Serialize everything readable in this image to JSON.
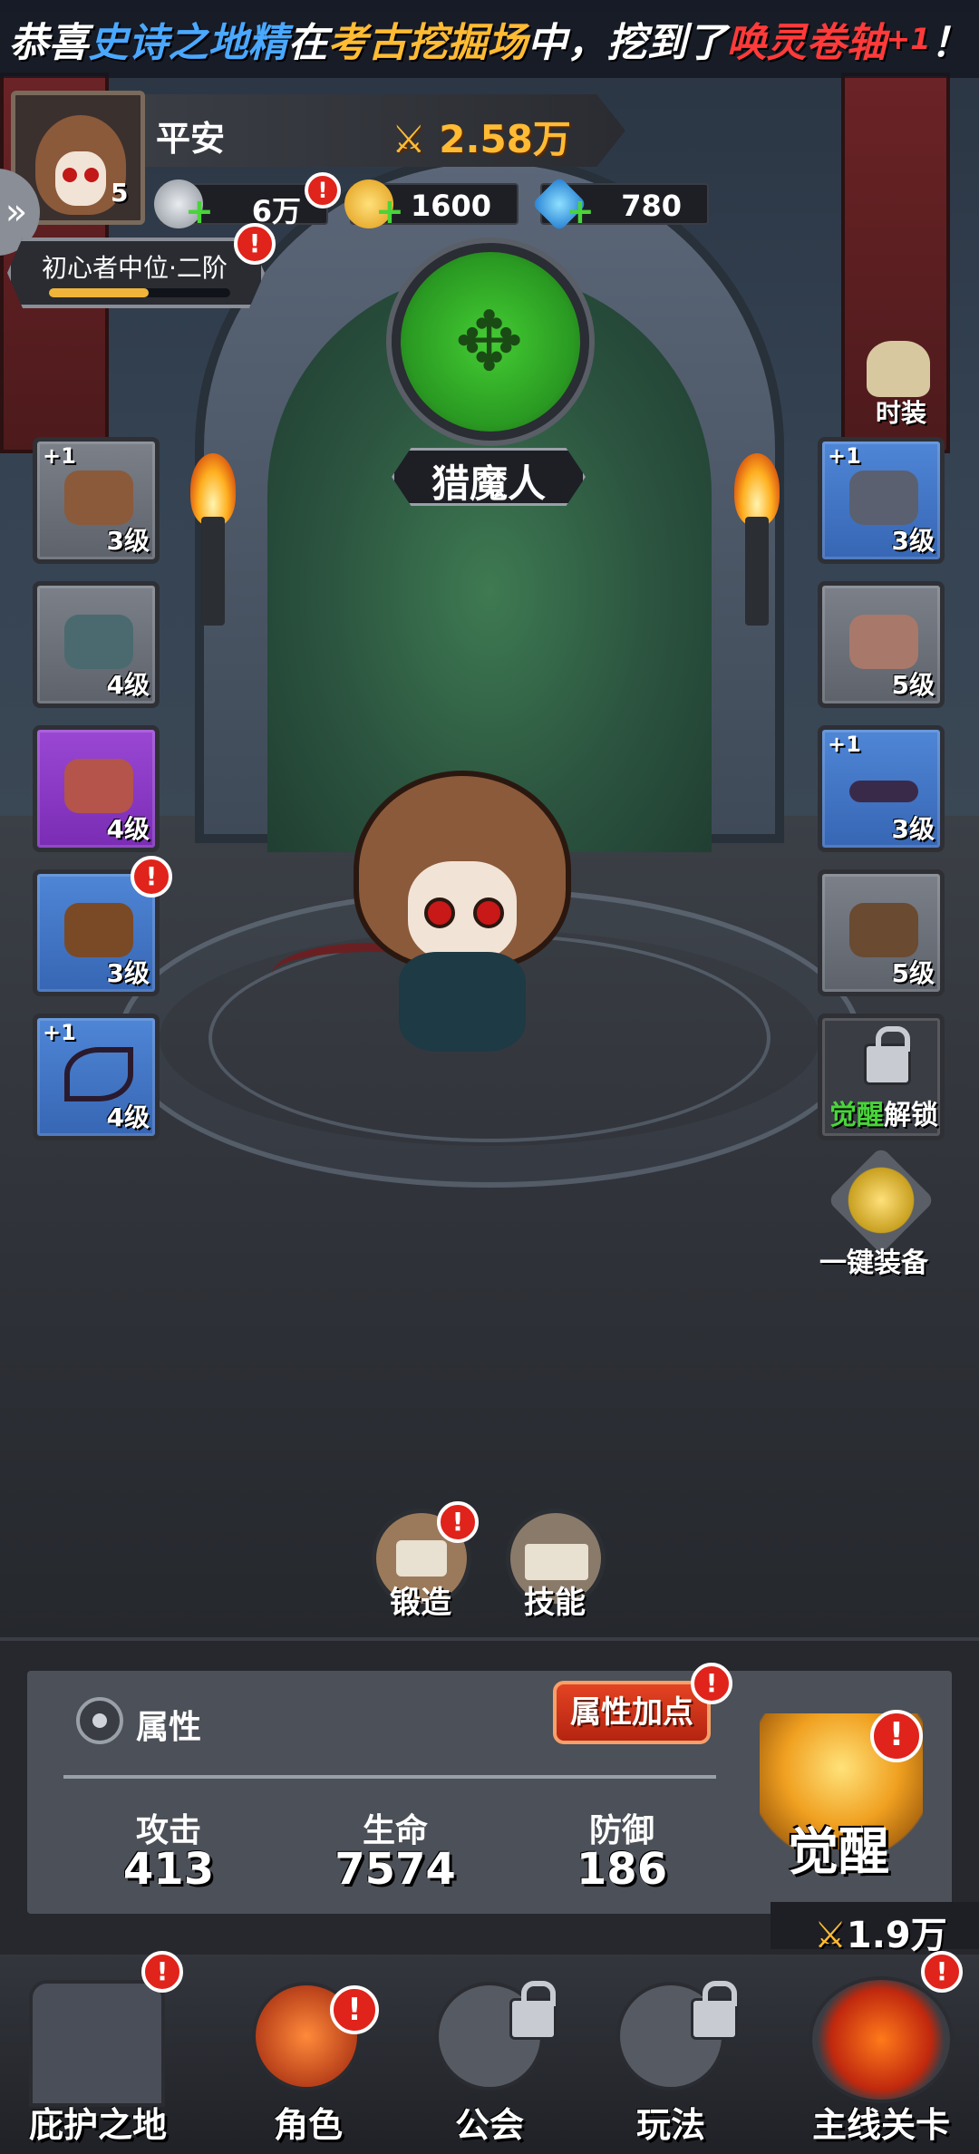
{
  "ticker": {
    "part1": "恭喜",
    "player": "史诗之地精",
    "part2": "在",
    "place": "考古挖掘场",
    "part3": "中，挖到了",
    "item": "唤灵卷轴",
    "qty": "+1",
    "end": "！"
  },
  "profile": {
    "name": "平安",
    "level": "5",
    "power": "2.58万",
    "rank": "初心者中位·二阶",
    "rank_progress": 0.55
  },
  "currency": {
    "silver": "6万",
    "gold": "1600",
    "gem": "780"
  },
  "class": {
    "name": "猎魔人"
  },
  "costume_label": "时装",
  "equipment_left": [
    {
      "plus": "+1",
      "level": "3级",
      "rarity": "gray",
      "icon": "hood-icon"
    },
    {
      "plus": "",
      "level": "4级",
      "rarity": "gray",
      "icon": "mask-icon"
    },
    {
      "plus": "",
      "level": "4级",
      "rarity": "purple",
      "icon": "cape-icon"
    },
    {
      "plus": "",
      "level": "3级",
      "rarity": "blue",
      "icon": "pants-icon"
    },
    {
      "plus": "+1",
      "level": "4级",
      "rarity": "blue",
      "icon": "bow-icon"
    }
  ],
  "equipment_right": [
    {
      "plus": "+1",
      "level": "3级",
      "rarity": "blue",
      "icon": "armor-icon"
    },
    {
      "plus": "",
      "level": "5级",
      "rarity": "gray",
      "icon": "bracer-icon"
    },
    {
      "plus": "+1",
      "level": "3级",
      "rarity": "blue",
      "icon": "belt-icon"
    },
    {
      "plus": "",
      "level": "5级",
      "rarity": "gray",
      "icon": "boots-icon"
    }
  ],
  "awaken_unlock": {
    "part1": "觉醒",
    "part2": "解锁"
  },
  "one_click_equip": "一键装备",
  "actions": {
    "forge": "锻造",
    "skill": "技能"
  },
  "attributes": {
    "title": "属性",
    "add_points": "属性加点",
    "attack_label": "攻击",
    "attack": "413",
    "hp_label": "生命",
    "hp": "7574",
    "defense_label": "防御",
    "defense": "186",
    "awaken": "觉醒",
    "power": "1.9万"
  },
  "nav": [
    {
      "label": "庇护之地"
    },
    {
      "label": "角色"
    },
    {
      "label": "公会"
    },
    {
      "label": "玩法"
    },
    {
      "label": "主线关卡"
    }
  ],
  "colors": {
    "accent_gold": "#ffbb33",
    "alert_red": "#e0231b",
    "class_green": "#2a9a22"
  }
}
